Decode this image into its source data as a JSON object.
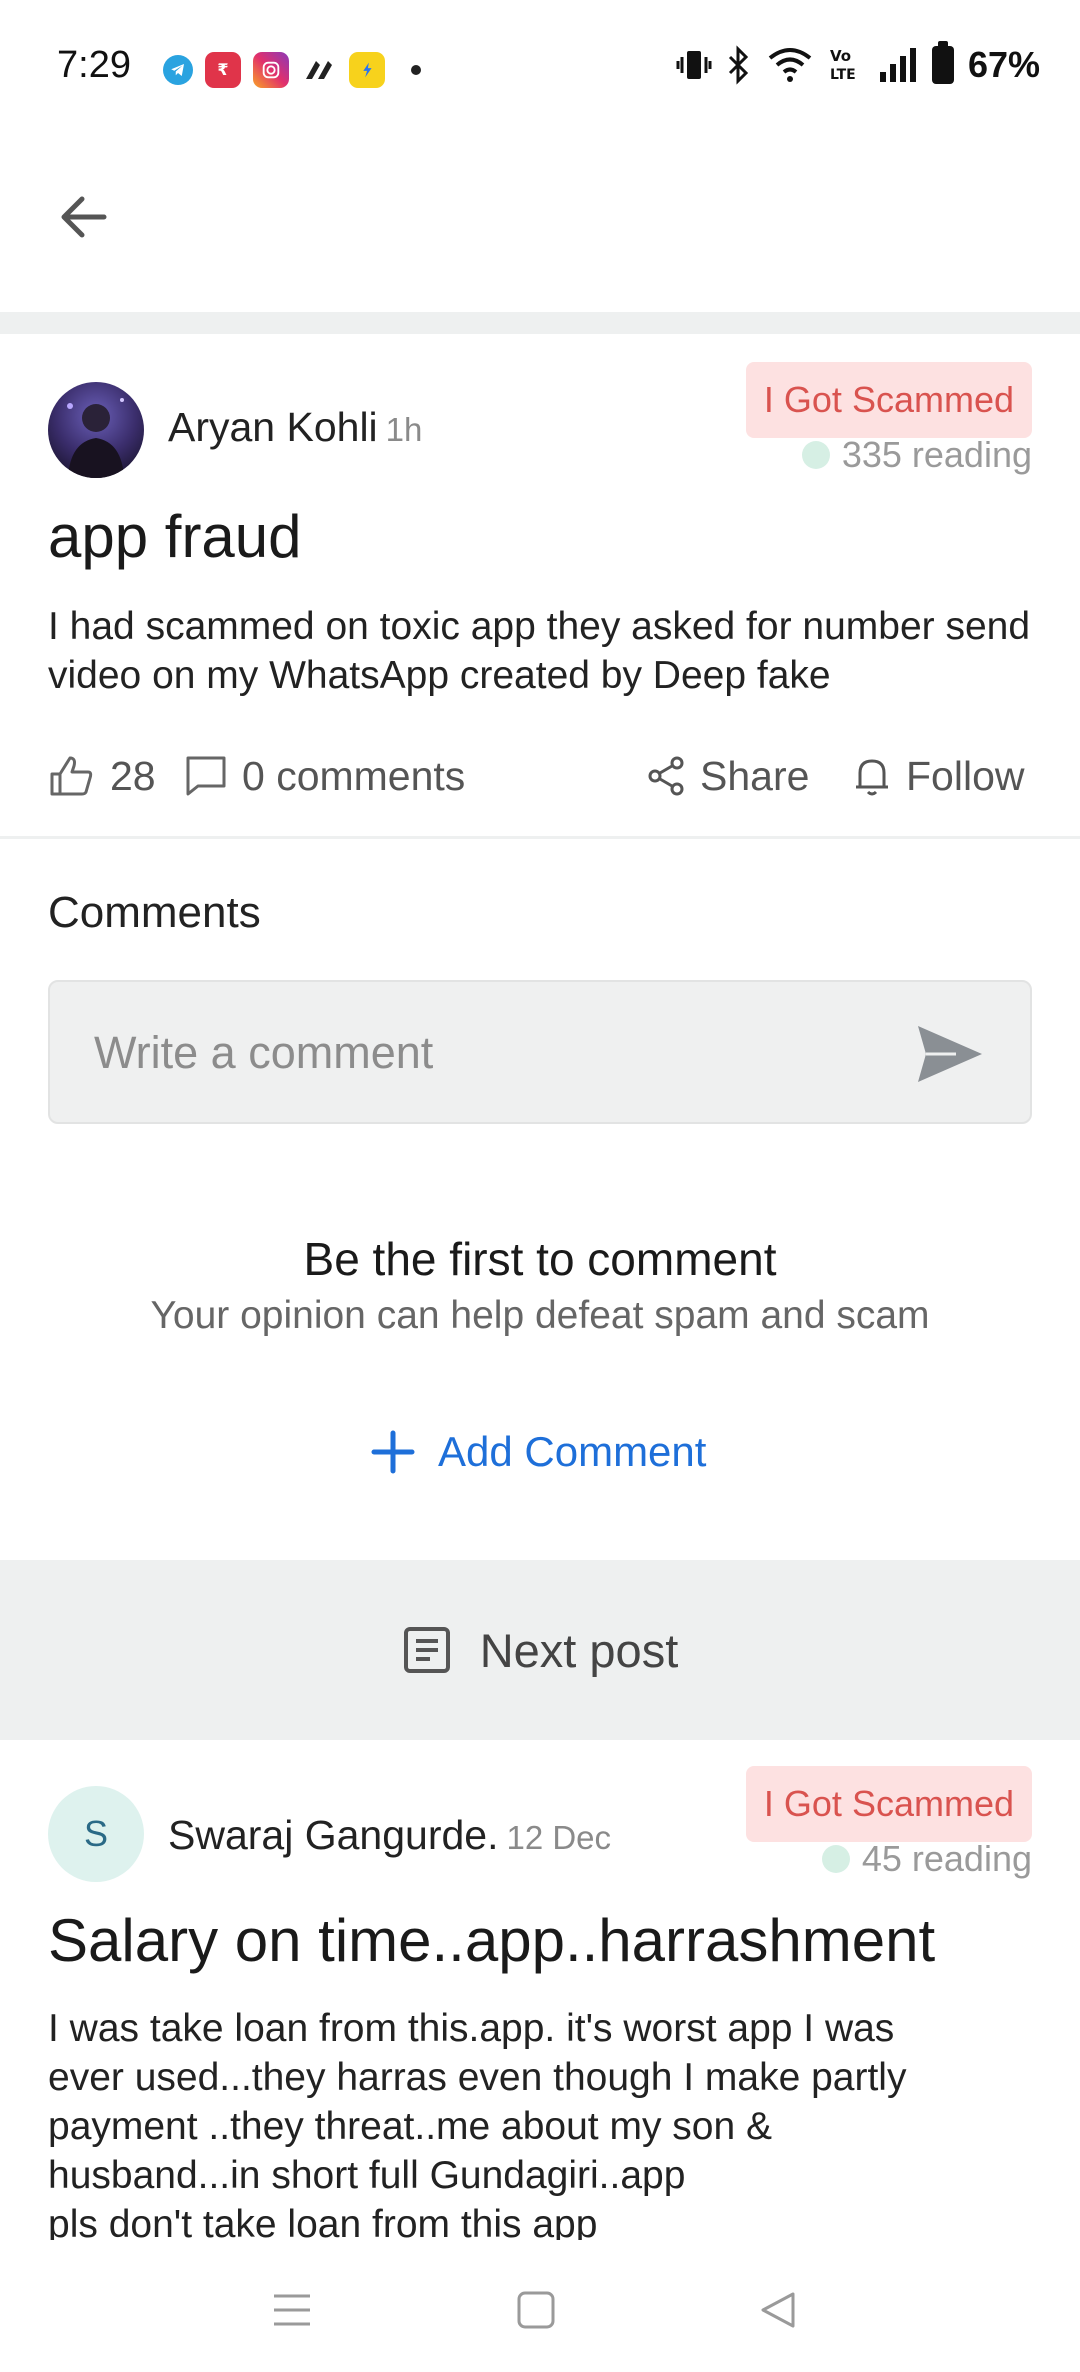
{
  "status_bar": {
    "time": "7:29",
    "battery": "67%",
    "app_icons": [
      "telegram-icon",
      "paytm-icon",
      "instagram-icon",
      "app-icon",
      "flipkart-icon"
    ]
  },
  "post": {
    "author": "Aryan Kohli",
    "time": "1h",
    "tag": "I Got Scammed",
    "reading": "335 reading",
    "title": "app fraud",
    "body": "I had scammed on toxic app they asked for number send video on my WhatsApp created by Deep fake",
    "likes": "28",
    "comments": "0 comments",
    "share": "Share",
    "follow": "Follow"
  },
  "comments_section": {
    "heading": "Comments",
    "placeholder": "Write a comment",
    "empty_title": "Be the first to comment",
    "empty_subtitle": "Your opinion can help defeat spam and scam",
    "add_comment": "Add Comment"
  },
  "next_post": {
    "label": "Next post"
  },
  "post2": {
    "avatar_letter": "S",
    "author": "Swaraj Gangurde.",
    "time": "12 Dec",
    "tag": "I Got Scammed",
    "reading": "45 reading",
    "title": "Salary on time..app..harrashment",
    "body_lines": [
      "I was take loan from this.app. it's worst app I was",
      "ever used...they harras even though I make partly",
      "payment ..they threat..me about my son &",
      "husband...in short full Gundagiri..app",
      "pls don't take loan from this app"
    ]
  },
  "colors": {
    "accent": "#1e6fd9",
    "tag_bg": "#fde1e1",
    "tag_text": "#d9534f",
    "band": "#eef0f0"
  }
}
